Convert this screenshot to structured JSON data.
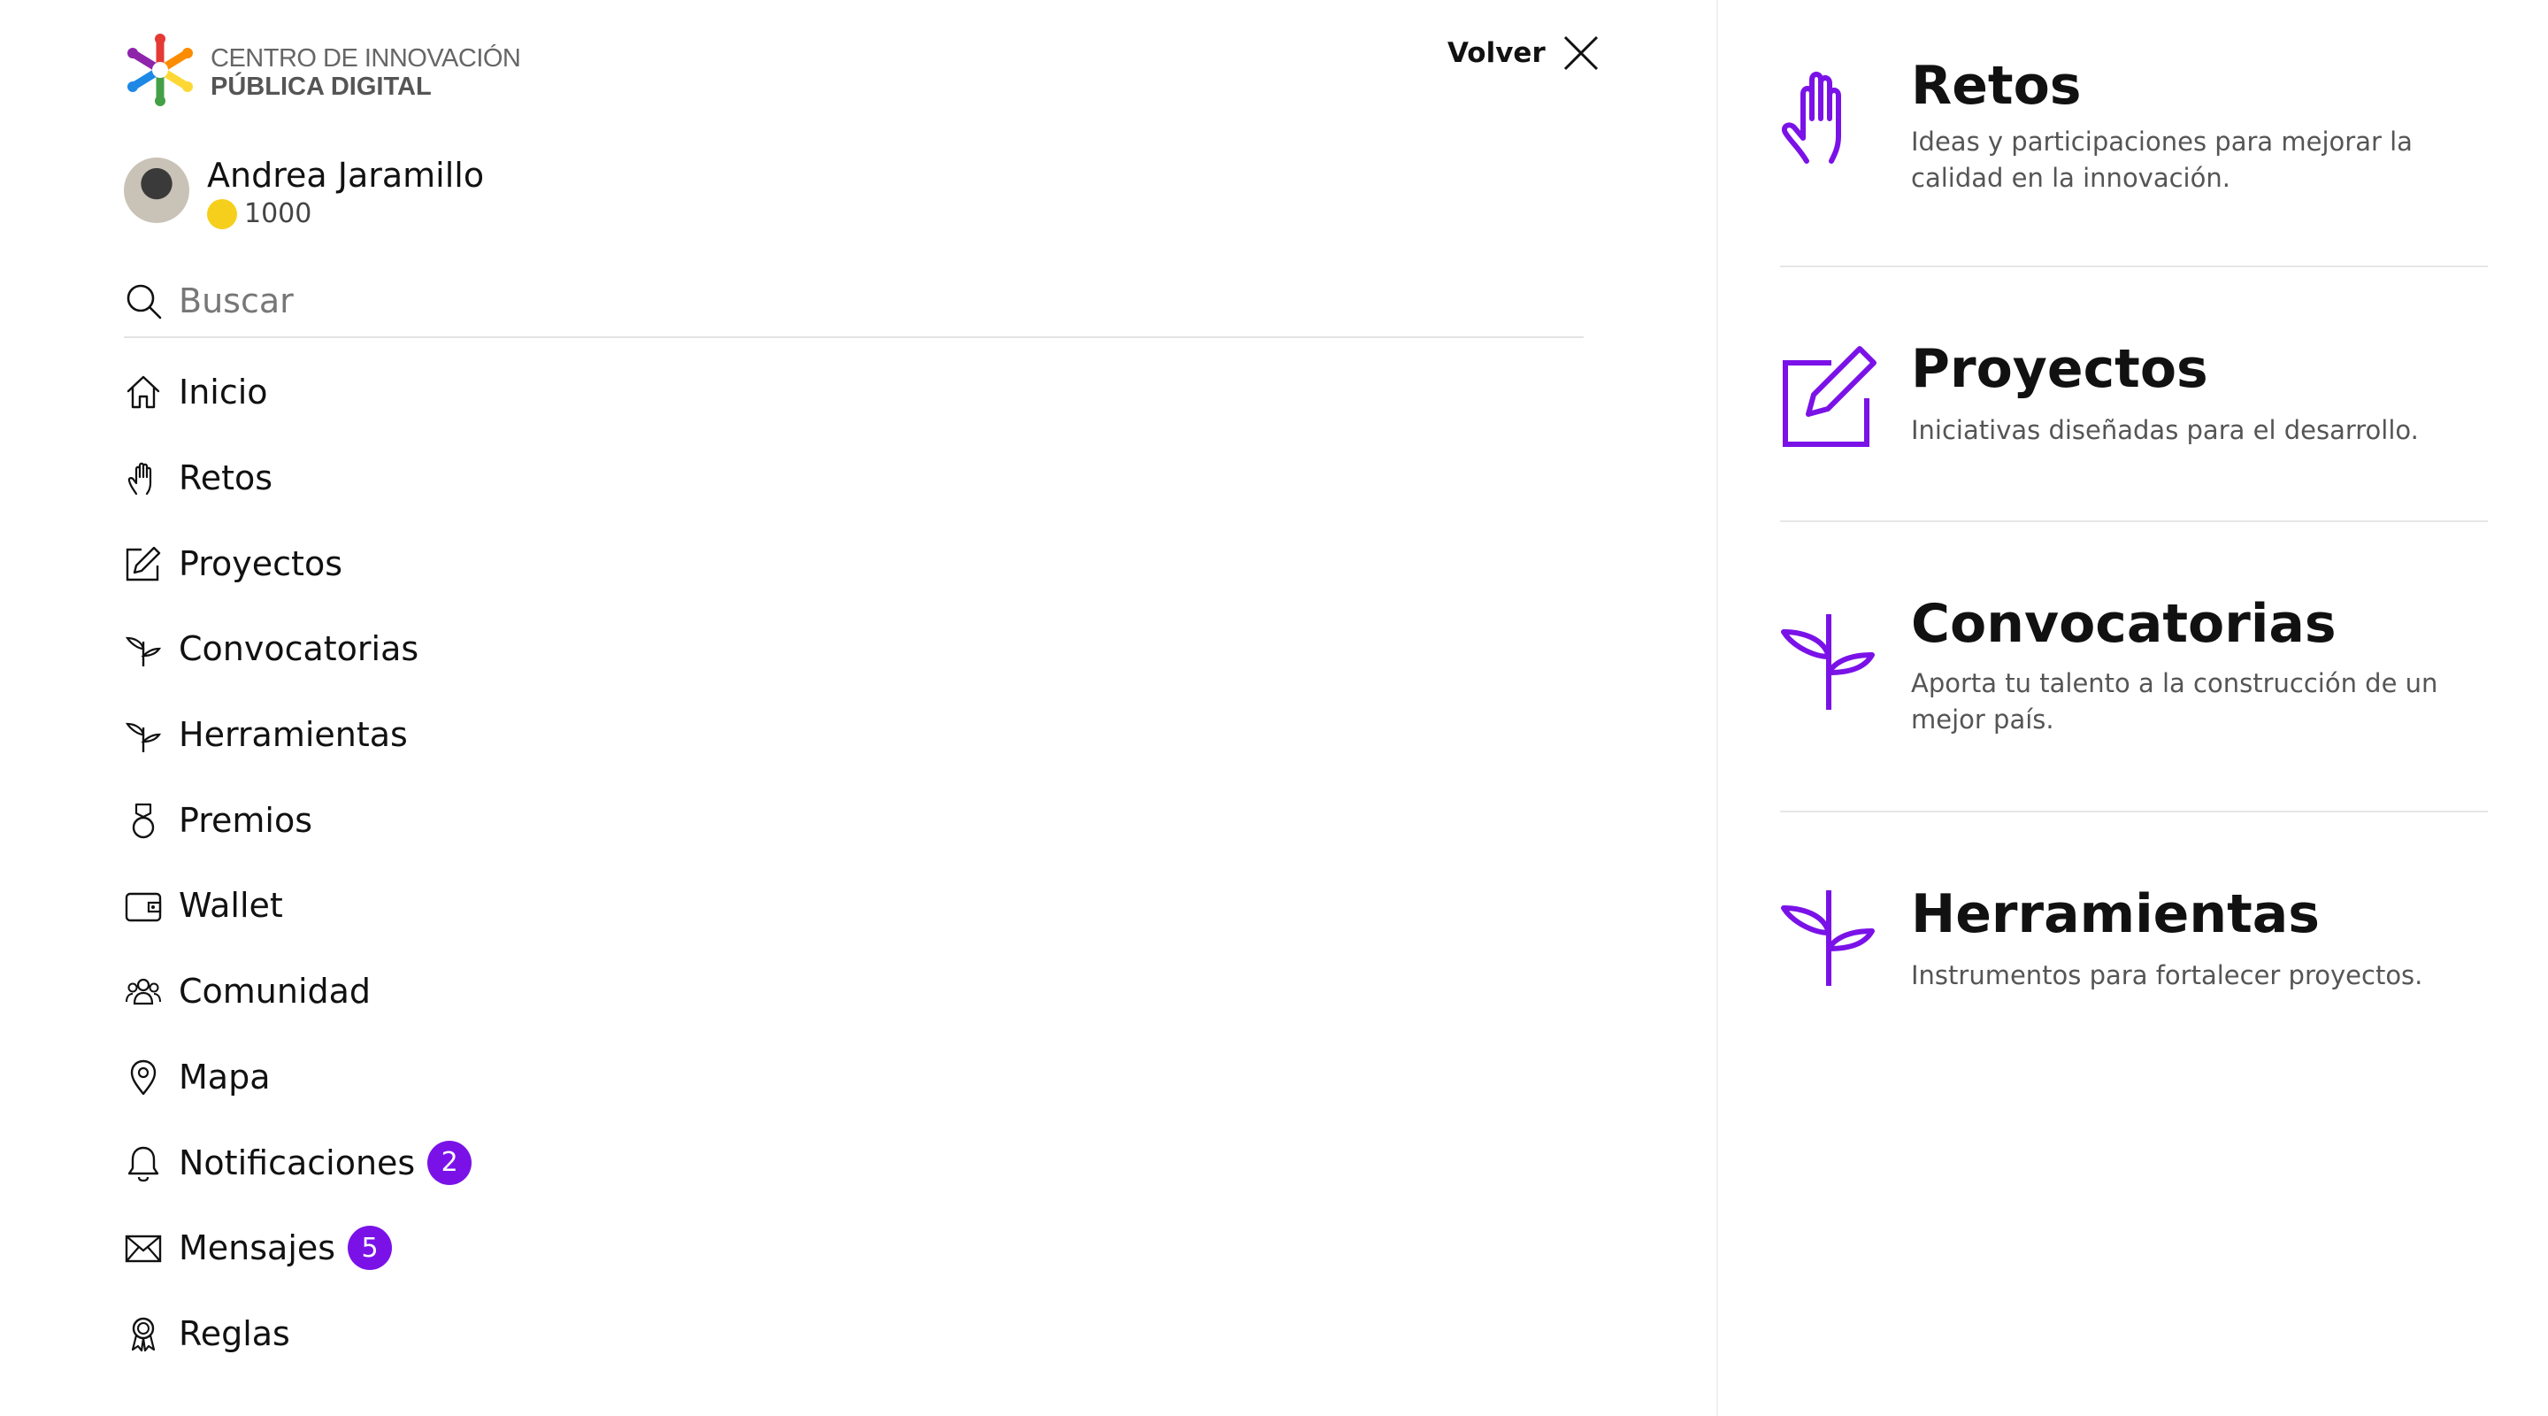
{
  "brand": {
    "line1": "CENTRO DE INNOVACIÓN",
    "line2": "PÚBLICA DIGITAL",
    "colors": [
      "#e53935",
      "#fb8c00",
      "#fdd835",
      "#43a047",
      "#1e88e5",
      "#8e24aa"
    ]
  },
  "header": {
    "back_label": "Volver",
    "close_icon": "close-icon"
  },
  "user": {
    "name": "Andrea Jaramillo",
    "points": "1000"
  },
  "search": {
    "placeholder": "Buscar"
  },
  "menu": {
    "items": [
      {
        "label": "Inicio",
        "icon": "home-icon"
      },
      {
        "label": "Retos",
        "icon": "hand-icon"
      },
      {
        "label": "Proyectos",
        "icon": "edit-icon"
      },
      {
        "label": "Convocatorias",
        "icon": "sprout-icon"
      },
      {
        "label": "Herramientas",
        "icon": "sprout-icon"
      },
      {
        "label": "Premios",
        "icon": "medal-icon"
      },
      {
        "label": "Wallet",
        "icon": "wallet-icon"
      },
      {
        "label": "Comunidad",
        "icon": "community-icon"
      },
      {
        "label": "Mapa",
        "icon": "map-pin-icon"
      },
      {
        "label": "Notificaciones",
        "icon": "bell-icon",
        "badge": "2"
      },
      {
        "label": "Mensajes",
        "icon": "mail-icon",
        "badge": "5"
      },
      {
        "label": "Reglas",
        "icon": "award-icon"
      }
    ]
  },
  "categories": [
    {
      "title": "Retos",
      "description": "Ideas  y participaciones para mejorar la calidad en la innovación.",
      "icon": "hand-icon"
    },
    {
      "title": "Proyectos",
      "description": "Iniciativas diseñadas para el desarrollo.",
      "icon": "edit-icon"
    },
    {
      "title": "Convocatorias",
      "description": "Aporta tu talento a la construcción de un mejor país.",
      "icon": "sprout-icon"
    },
    {
      "title": "Herramientas",
      "description": "Instrumentos para fortalecer proyectos.",
      "icon": "sprout-icon"
    }
  ],
  "theme": {
    "accent": "#7a12e8",
    "badge_bg": "#7a12e8",
    "coin": "#f5cf1c"
  }
}
